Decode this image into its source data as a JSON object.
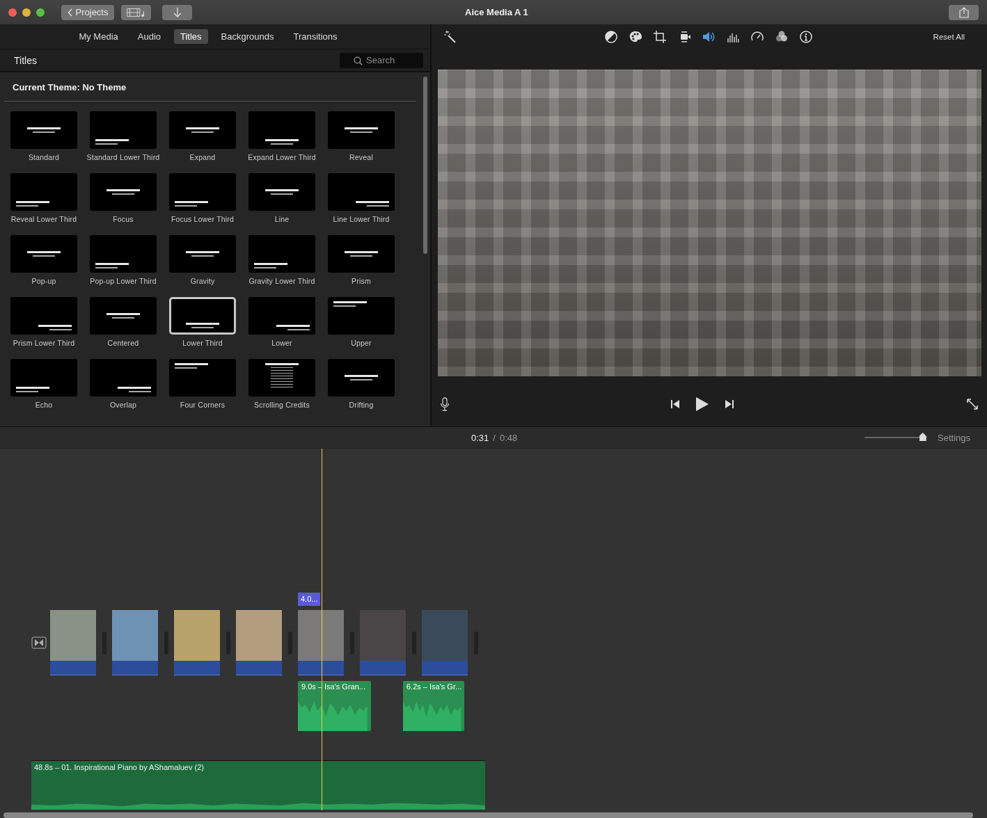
{
  "window": {
    "title": "Aice Media A 1"
  },
  "toolbar": {
    "projects_button": "Projects"
  },
  "browser_tabs": [
    {
      "label": "My Media",
      "selected": false
    },
    {
      "label": "Audio",
      "selected": false
    },
    {
      "label": "Titles",
      "selected": true
    },
    {
      "label": "Backgrounds",
      "selected": false
    },
    {
      "label": "Transitions",
      "selected": false
    }
  ],
  "browser": {
    "heading": "Titles",
    "search": {
      "placeholder": "Search"
    },
    "theme_label": "Current Theme: No Theme"
  },
  "titles": [
    {
      "name": "Standard",
      "selected": false,
      "kind": "center"
    },
    {
      "name": "Standard Lower Third",
      "selected": false,
      "kind": "lowleft"
    },
    {
      "name": "Expand",
      "selected": false,
      "kind": "center"
    },
    {
      "name": "Expand Lower Third",
      "selected": false,
      "kind": "lowcenter"
    },
    {
      "name": "Reveal",
      "selected": false,
      "kind": "center"
    },
    {
      "name": "Reveal Lower Third",
      "selected": false,
      "kind": "lowleft"
    },
    {
      "name": "Focus",
      "selected": false,
      "kind": "center"
    },
    {
      "name": "Focus Lower Third",
      "selected": false,
      "kind": "lowleft"
    },
    {
      "name": "Line",
      "selected": false,
      "kind": "center"
    },
    {
      "name": "Line Lower Third",
      "selected": false,
      "kind": "lowright"
    },
    {
      "name": "Pop-up",
      "selected": false,
      "kind": "center"
    },
    {
      "name": "Pop-up Lower Third",
      "selected": false,
      "kind": "lowleft"
    },
    {
      "name": "Gravity",
      "selected": false,
      "kind": "center"
    },
    {
      "name": "Gravity Lower Third",
      "selected": false,
      "kind": "lowleft"
    },
    {
      "name": "Prism",
      "selected": false,
      "kind": "center"
    },
    {
      "name": "Prism Lower Third",
      "selected": false,
      "kind": "lowright"
    },
    {
      "name": "Centered",
      "selected": false,
      "kind": "center"
    },
    {
      "name": "Lower Third",
      "selected": true,
      "kind": "lowcenter"
    },
    {
      "name": "Lower",
      "selected": false,
      "kind": "lowright"
    },
    {
      "name": "Upper",
      "selected": false,
      "kind": "upleft"
    },
    {
      "name": "Echo",
      "selected": false,
      "kind": "lowleft"
    },
    {
      "name": "Overlap",
      "selected": false,
      "kind": "lowright"
    },
    {
      "name": "Four Corners",
      "selected": false,
      "kind": "upleft"
    },
    {
      "name": "Scrolling Credits",
      "selected": false,
      "kind": "credits"
    },
    {
      "name": "Drifting",
      "selected": false,
      "kind": "center"
    }
  ],
  "inspector": {
    "reset_button": "Reset All",
    "tools": [
      {
        "kind": "balance",
        "selected": false
      },
      {
        "kind": "palette",
        "selected": false
      },
      {
        "kind": "crop",
        "selected": false
      },
      {
        "kind": "stabilize",
        "selected": false
      },
      {
        "kind": "volume",
        "selected": true
      },
      {
        "kind": "equalizer",
        "selected": false
      },
      {
        "kind": "speed",
        "selected": false
      },
      {
        "kind": "filter",
        "selected": false
      },
      {
        "kind": "info",
        "selected": false
      }
    ]
  },
  "timeline": {
    "time_current": "0:31",
    "time_separator": "/",
    "time_total": "0:48",
    "settings_button": "Settings",
    "zoom": {
      "level": 0.93
    },
    "clips": [
      {
        "color": "#8a9288"
      },
      {
        "color": "#6f93b5"
      },
      {
        "color": "#b8a36a"
      },
      {
        "color": "#b29d7e"
      },
      {
        "color": "#7c7a78"
      },
      {
        "color": "#4a4546"
      },
      {
        "color": "#3b4a5a"
      }
    ],
    "title_clip": "4.0...",
    "audio_clips": [
      "9.0s – Isa's Gran...",
      "6.2s – Isa's Gr..."
    ],
    "music_clip": "48.8s – 01. Inspirational Piano by AShamaluev (2)"
  }
}
